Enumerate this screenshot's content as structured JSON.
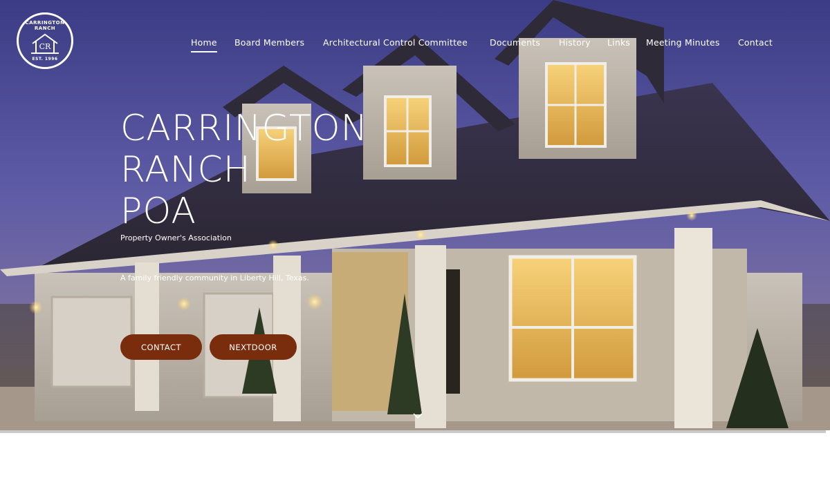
{
  "logo": {
    "name_line1": "CARRINGTON",
    "name_line2": "RANCH",
    "initials": "CR",
    "established": "EST. 1996",
    "icon": "house-icon"
  },
  "nav": {
    "items": [
      {
        "label": "Home",
        "active": true
      },
      {
        "label": "Board Members",
        "active": false
      },
      {
        "label": "Architectural Control Committee",
        "active": false
      },
      {
        "label": "Documents",
        "active": false
      },
      {
        "label": "History",
        "active": false
      },
      {
        "label": "Links",
        "active": false
      },
      {
        "label": "Meeting Minutes",
        "active": false
      },
      {
        "label": "Contact",
        "active": false
      }
    ]
  },
  "hero": {
    "title_lines": [
      "CARRINGTON",
      "RANCH",
      "POA"
    ],
    "subtitle": "Property Owner's Association",
    "tagline": "A family friendly community in Liberty Hill, Texas.",
    "buttons": {
      "contact": "CONTACT",
      "nextdoor": "NEXTDOOR"
    },
    "scroll_icon": "chevron-down-icon",
    "background_image": "house-at-dusk-photo"
  },
  "colors": {
    "button_bg": "#7a2d0c",
    "sky_top": "#3f3f86",
    "sky_bottom": "#8a7a6e",
    "text": "#ffffff"
  }
}
